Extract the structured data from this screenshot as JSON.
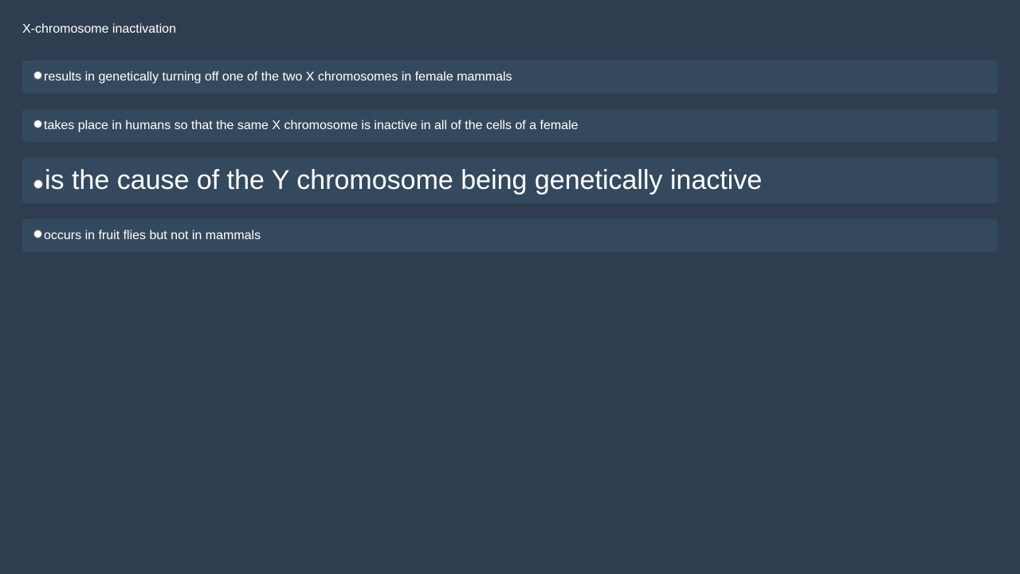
{
  "question": {
    "text": "X-chromosome inactivation"
  },
  "options": [
    {
      "label": "results in genetically turning off one of the two X chromosomes in female mammals",
      "selected": false
    },
    {
      "label": "takes place in humans so that the same X chromosome is inactive in all of the cells of a female",
      "selected": false
    },
    {
      "label": "is the cause of the Y chromosome being genetically inactive",
      "selected": false
    },
    {
      "label": "occurs in fruit flies but not in mammals",
      "selected": false
    }
  ],
  "colors": {
    "background": "#2e3e50",
    "option_background": "#34495e",
    "text": "#ffffff"
  }
}
